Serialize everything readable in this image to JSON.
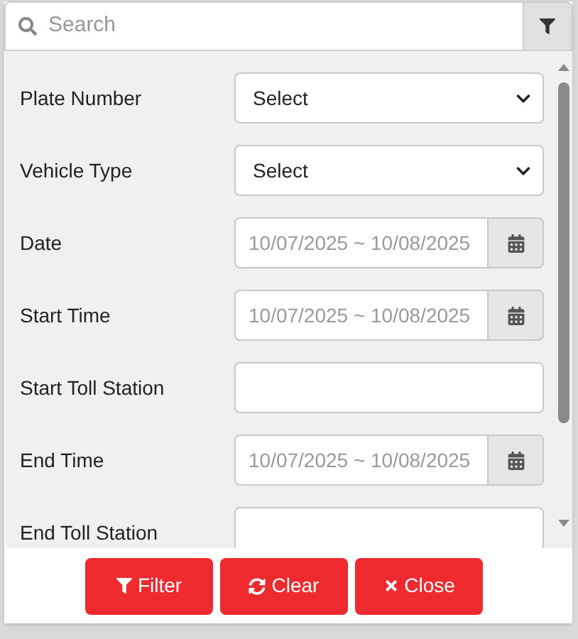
{
  "search": {
    "placeholder": "Search"
  },
  "fields": [
    {
      "kind": "select",
      "label": "Plate Number",
      "value": "Select"
    },
    {
      "kind": "select",
      "label": "Vehicle Type",
      "value": "Select"
    },
    {
      "kind": "daterange",
      "label": "Date",
      "placeholder": "10/07/2025 ~ 10/08/2025"
    },
    {
      "kind": "daterange",
      "label": "Start Time",
      "placeholder": "10/07/2025 ~ 10/08/2025"
    },
    {
      "kind": "text",
      "label": "Start Toll Station"
    },
    {
      "kind": "daterange",
      "label": "End Time",
      "placeholder": "10/07/2025 ~ 10/08/2025"
    },
    {
      "kind": "text",
      "label": "End Toll Station"
    }
  ],
  "buttons": [
    {
      "kind": "filter",
      "label": "Filter"
    },
    {
      "kind": "clear",
      "label": "Clear"
    },
    {
      "kind": "close",
      "label": "Close"
    }
  ]
}
